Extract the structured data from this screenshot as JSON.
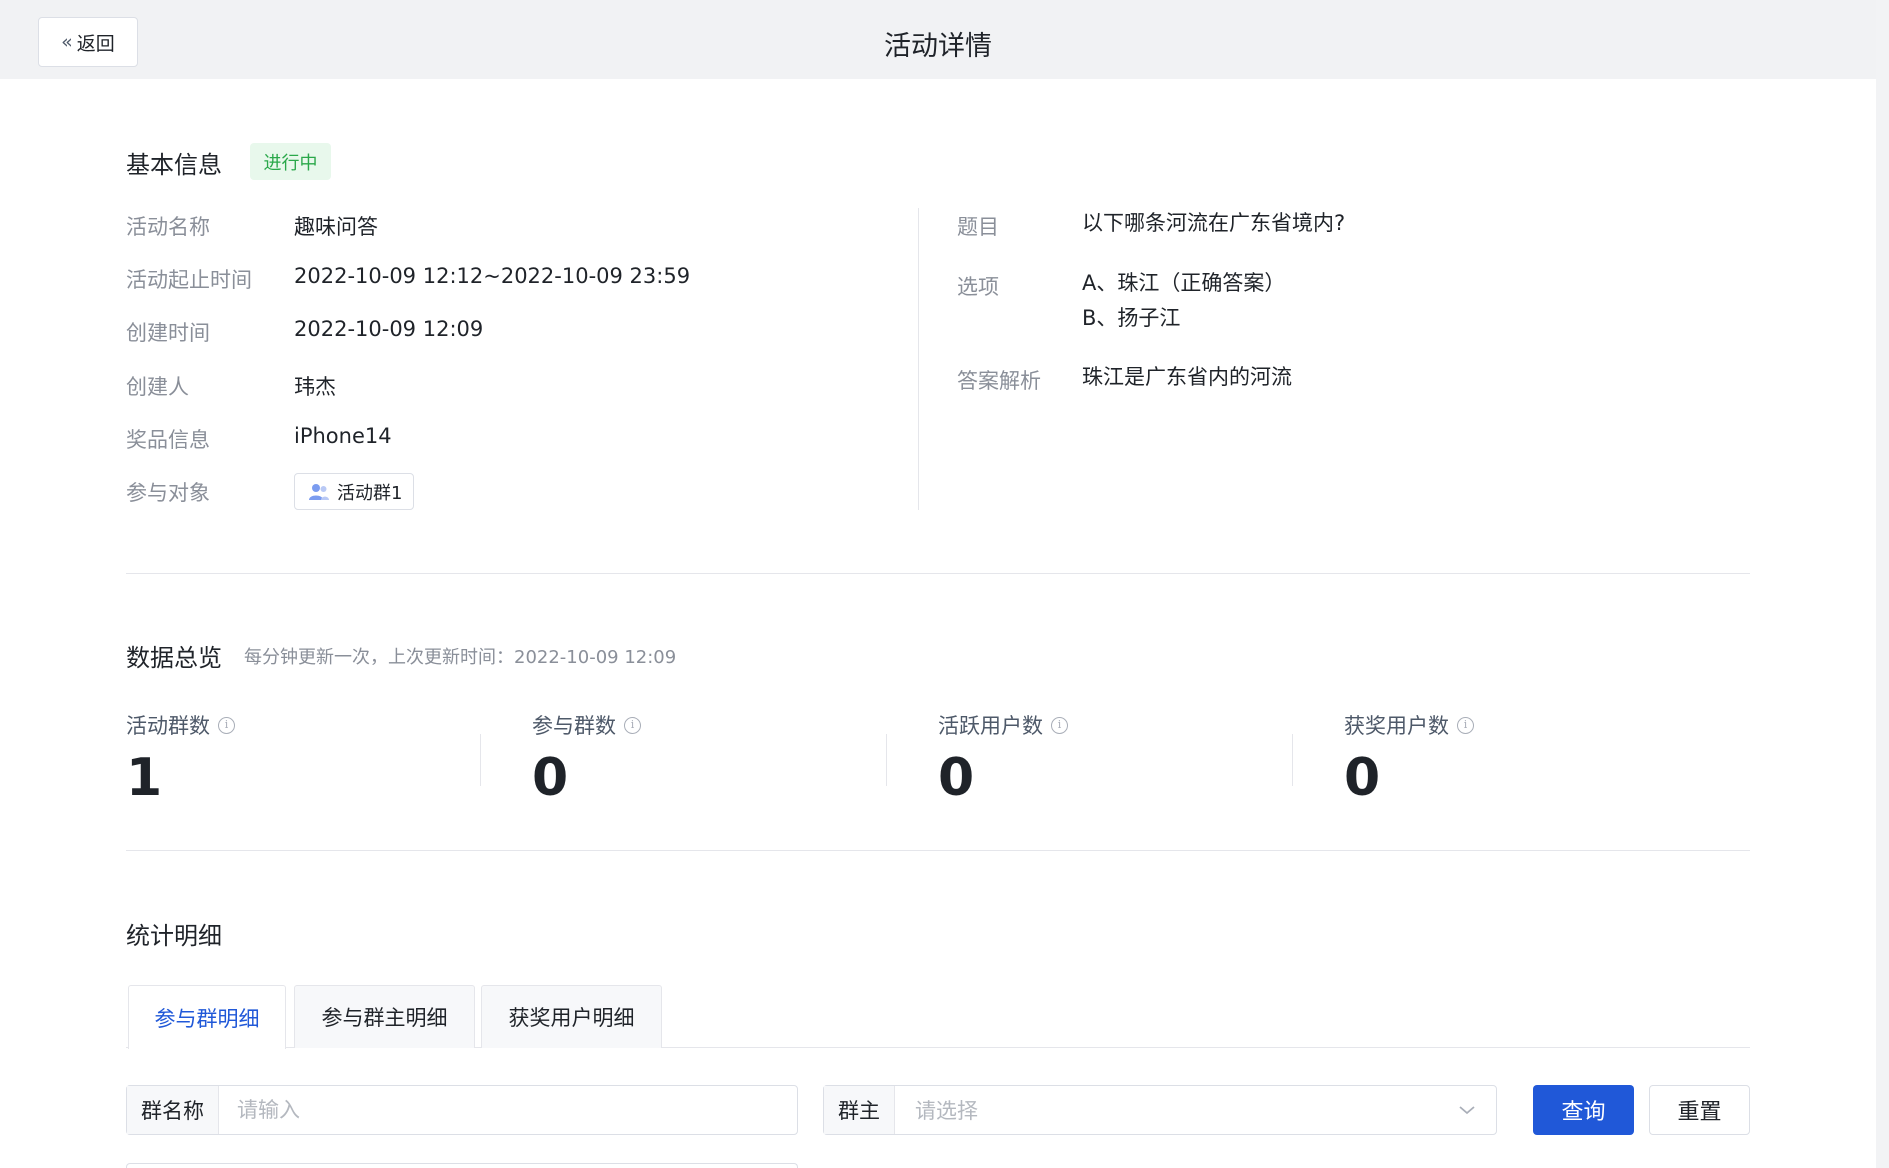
{
  "header": {
    "back_label": "返回",
    "title": "活动详情"
  },
  "basic_info": {
    "title": "基本信息",
    "status": "进行中",
    "fields": [
      {
        "label": "活动名称",
        "value": "趣味问答"
      },
      {
        "label": "活动起止时间",
        "value": "2022-10-09 12:12~2022-10-09 23:59"
      },
      {
        "label": "创建时间",
        "value": "2022-10-09 12:09"
      },
      {
        "label": "创建人",
        "value": "玮杰"
      },
      {
        "label": "奖品信息",
        "value": "iPhone14"
      },
      {
        "label": "参与对象",
        "value": "活动群1"
      }
    ],
    "question": {
      "label": "题目",
      "value": "以下哪条河流在广东省境内?"
    },
    "options": {
      "label": "选项",
      "items": [
        "A、珠江（正确答案）",
        "B、扬子江"
      ]
    },
    "analysis": {
      "label": "答案解析",
      "value": "珠江是广东省内的河流"
    }
  },
  "overview": {
    "title": "数据总览",
    "note": "每分钟更新一次，上次更新时间：2022-10-09 12:09",
    "stats": [
      {
        "label": "活动群数",
        "value": "1"
      },
      {
        "label": "参与群数",
        "value": "0"
      },
      {
        "label": "活跃用户数",
        "value": "0"
      },
      {
        "label": "获奖用户数",
        "value": "0"
      }
    ]
  },
  "details": {
    "title": "统计明细",
    "tabs": [
      "参与群明细",
      "参与群主明细",
      "获奖用户明细"
    ],
    "filters": {
      "group_name_label": "群名称",
      "group_name_placeholder": "请输入",
      "owner_label": "群主",
      "owner_placeholder": "请选择"
    },
    "query_label": "查询",
    "reset_label": "重置"
  },
  "colors": {
    "primary": "#2058d8",
    "status_green": "#2aa84a",
    "status_bg": "#e8f8ec"
  }
}
